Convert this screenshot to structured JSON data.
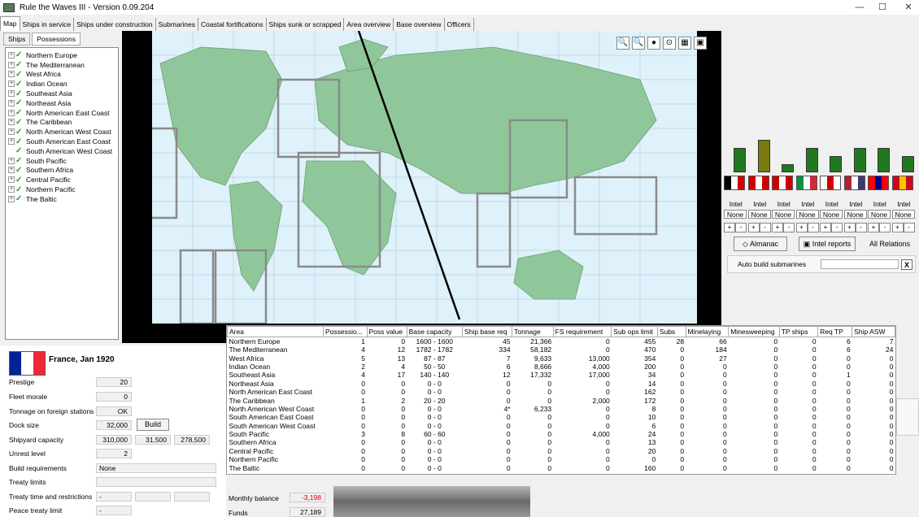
{
  "window": {
    "title": "Rule the Waves III - Version 0.09.204",
    "minimize": "—",
    "maximize": "☐",
    "close": "✕"
  },
  "tabs": [
    "Map",
    "Ships in service",
    "Ships under construction",
    "Submarines",
    "Coastal fortifications",
    "Ships sunk or scrapped",
    "Area overview",
    "Base overview",
    "Officers"
  ],
  "subtabs": [
    "Ships",
    "Possessions"
  ],
  "tree": [
    {
      "label": "Northern Europe",
      "expand": "+"
    },
    {
      "label": "The Mediterranean",
      "expand": "+"
    },
    {
      "label": "West Africa",
      "expand": "+"
    },
    {
      "label": "Indian Ocean",
      "expand": "+"
    },
    {
      "label": "Southeast Asia",
      "expand": "+"
    },
    {
      "label": "Northeast Asia",
      "expand": "+"
    },
    {
      "label": "North American East Coast",
      "expand": "+"
    },
    {
      "label": "The Caribbean",
      "expand": "+"
    },
    {
      "label": "North American West Coast",
      "expand": "+"
    },
    {
      "label": "South American East Coast",
      "expand": "+"
    },
    {
      "label": "South American West Coast",
      "expand": ""
    },
    {
      "label": "South Pacific",
      "expand": "+"
    },
    {
      "label": "Southern Africa",
      "expand": "+"
    },
    {
      "label": "Central Pacific",
      "expand": "+"
    },
    {
      "label": "Northern Pacific",
      "expand": "+"
    },
    {
      "label": "The Baltic",
      "expand": "+"
    }
  ],
  "map_tools": [
    "🔍",
    "🔍",
    "●",
    "⊙",
    "▦",
    "▣"
  ],
  "intel": {
    "bars": [
      {
        "value": 0.67,
        "color": "#1f7a1f"
      },
      {
        "value": 0.89,
        "color": "#7a7a10"
      },
      {
        "value": 0.22,
        "color": "#1f7a1f"
      },
      {
        "value": 0.67,
        "color": "#1f7a1f"
      },
      {
        "value": 0.44,
        "color": "#1f7a1f"
      },
      {
        "value": 0.67,
        "color": "#1f7a1f"
      },
      {
        "value": 0.67,
        "color": "#1f7a1f"
      },
      {
        "value": 0.44,
        "color": "#1f7a1f"
      }
    ],
    "flags": [
      {
        "colors": [
          "#000000",
          "#ffffff",
          "#d00000"
        ]
      },
      {
        "colors": [
          "#d00000",
          "#ffffff",
          "#d00000"
        ]
      },
      {
        "colors": [
          "#cc0000",
          "#ffffff",
          "#cc0000"
        ]
      },
      {
        "colors": [
          "#009246",
          "#ffffff",
          "#ce2b37"
        ]
      },
      {
        "colors": [
          "#ffffff",
          "#d00000",
          "#ffffff"
        ]
      },
      {
        "colors": [
          "#b22234",
          "#ffffff",
          "#3c3b6e"
        ]
      },
      {
        "colors": [
          "#fe0000",
          "#000095",
          "#fe0000"
        ]
      },
      {
        "colors": [
          "#c60b1e",
          "#ffc400",
          "#c60b1e"
        ]
      }
    ],
    "labels": [
      "Intel",
      "Intel",
      "Intel",
      "Intel",
      "Intel",
      "Intel",
      "Intel",
      "Intel"
    ],
    "values": [
      "None",
      "None",
      "None",
      "None",
      "None",
      "None",
      "None",
      "None"
    ],
    "plus": "+",
    "minus": "-"
  },
  "buttons": {
    "almanac": "Almanac",
    "intel_reports": "Intel reports",
    "all_relations": "All Relations",
    "auto_build": "Auto build submarines",
    "x": "X"
  },
  "nation": {
    "name": "France, Jan 1920",
    "flag": [
      "#002395",
      "#ffffff",
      "#ed2939"
    ]
  },
  "stats": {
    "prestige_label": "Prestige",
    "prestige": "20",
    "morale_label": "Fleet morale",
    "morale": "0",
    "tonnage_label": "Tonnage on foreign stations",
    "tonnage": "OK",
    "dock_label": "Dock size",
    "dock": "32,000",
    "build": "Build",
    "shipyard_label": "Shipyard capacity",
    "shipyard1": "310,000",
    "shipyard2": "31,500",
    "shipyard3": "278,500",
    "unrest_label": "Unrest level",
    "unrest": "2",
    "buildreq_label": "Build requirements",
    "buildreq": "None",
    "treaty_label": "Treaty limits",
    "treatytime_label": "Treaty time and restrictions",
    "treatytime": "-",
    "peace_label": "Peace treaty limit",
    "peace": "-"
  },
  "money": {
    "monthly_label": "Monthly balance",
    "monthly": "-3,198",
    "funds_label": "Funds",
    "funds": "27,189"
  },
  "area_table": {
    "headers": [
      "Area",
      "Possessio...",
      "Poss value",
      "Base capacity",
      "Ship base req",
      "Tonnage",
      "FS requirement",
      "Sub ops limit",
      "Subs",
      "Minelaying",
      "Minesweeping",
      "TP ships",
      "Req TP",
      "Ship ASW"
    ],
    "rows": [
      [
        "Northern Europe",
        "1",
        "0",
        "1600 - 1600",
        "45",
        "21,366",
        "0",
        "455",
        "28",
        "66",
        "0",
        "0",
        "6",
        "7"
      ],
      [
        "The Mediterranean",
        "4",
        "12",
        "1782 - 1782",
        "334",
        "58,182",
        "0",
        "470",
        "0",
        "184",
        "0",
        "0",
        "6",
        "24"
      ],
      [
        "West Africa",
        "5",
        "13",
        "87 - 87",
        "7",
        "9,633",
        "13,000",
        "354",
        "0",
        "27",
        "0",
        "0",
        "0",
        "0"
      ],
      [
        "Indian Ocean",
        "2",
        "4",
        "50 - 50",
        "6",
        "8,666",
        "4,000",
        "200",
        "0",
        "0",
        "0",
        "0",
        "0",
        "0"
      ],
      [
        "Southeast Asia",
        "4",
        "17",
        "140 - 140",
        "12",
        "17,332",
        "17,000",
        "34",
        "0",
        "0",
        "0",
        "0",
        "1",
        "0"
      ],
      [
        "Northeast Asia",
        "0",
        "0",
        "0 - 0",
        "0",
        "0",
        "0",
        "14",
        "0",
        "0",
        "0",
        "0",
        "0",
        "0"
      ],
      [
        "North American East Coast",
        "0",
        "0",
        "0 - 0",
        "0",
        "0",
        "0",
        "162",
        "0",
        "0",
        "0",
        "0",
        "0",
        "0"
      ],
      [
        "The Caribbean",
        "1",
        "2",
        "20 - 20",
        "0",
        "0",
        "2,000",
        "172",
        "0",
        "0",
        "0",
        "0",
        "0",
        "0"
      ],
      [
        "North American West Coast",
        "0",
        "0",
        "0 - 0",
        "4*",
        "6,233",
        "0",
        "8",
        "0",
        "0",
        "0",
        "0",
        "0",
        "0"
      ],
      [
        "South American East Coast",
        "0",
        "0",
        "0 - 0",
        "0",
        "0",
        "0",
        "10",
        "0",
        "0",
        "0",
        "0",
        "0",
        "0"
      ],
      [
        "South American West Coast",
        "0",
        "0",
        "0 - 0",
        "0",
        "0",
        "0",
        "6",
        "0",
        "0",
        "0",
        "0",
        "0",
        "0"
      ],
      [
        "South Pacific",
        "3",
        "8",
        "60 - 60",
        "0",
        "0",
        "4,000",
        "24",
        "0",
        "0",
        "0",
        "0",
        "0",
        "0"
      ],
      [
        "Southern Africa",
        "0",
        "0",
        "0 - 0",
        "0",
        "0",
        "0",
        "13",
        "0",
        "0",
        "0",
        "0",
        "0",
        "0"
      ],
      [
        "Central Pacific",
        "0",
        "0",
        "0 - 0",
        "0",
        "0",
        "0",
        "20",
        "0",
        "0",
        "0",
        "0",
        "0",
        "0"
      ],
      [
        "Northern Pacific",
        "0",
        "0",
        "0 - 0",
        "0",
        "0",
        "0",
        "0",
        "0",
        "0",
        "0",
        "0",
        "0",
        "0"
      ],
      [
        "The Baltic",
        "0",
        "0",
        "0 - 0",
        "0",
        "0",
        "0",
        "160",
        "0",
        "0",
        "0",
        "0",
        "0",
        "0"
      ]
    ]
  }
}
